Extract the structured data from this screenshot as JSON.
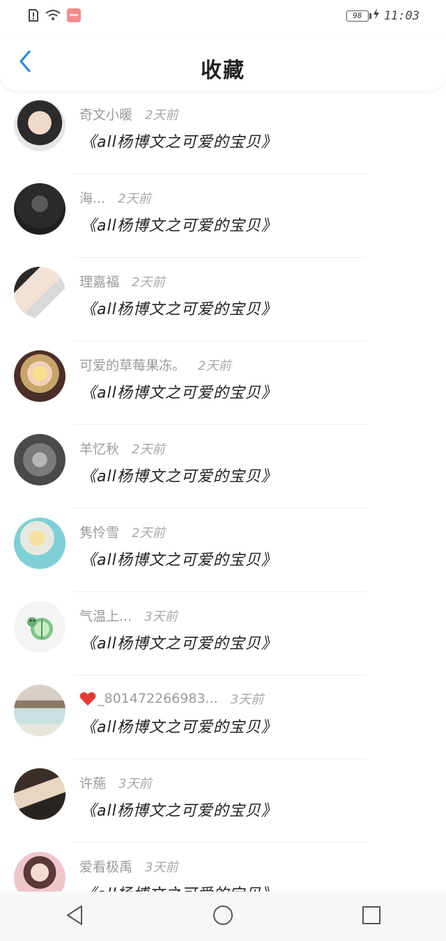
{
  "status_bar": {
    "battery": "98",
    "time": "11:03"
  },
  "header": {
    "title": "收藏"
  },
  "items": [
    {
      "username": "奇文小暖",
      "time": "2天前",
      "title": "《all杨博文之可爱的宝贝》",
      "avatar_color": "#3a3a3a"
    },
    {
      "username": "海...",
      "time": "2天前",
      "title": "《all杨博文之可爱的宝贝》",
      "avatar_color": "#2b2b2b"
    },
    {
      "username": "理嘉福",
      "time": "2天前",
      "title": "《all杨博文之可爱的宝贝》",
      "avatar_color": "#c9b8a8"
    },
    {
      "username": "可爱的草莓果冻。",
      "time": "2天前",
      "title": "《all杨博文之可爱的宝贝》",
      "avatar_color": "#6a4a3a"
    },
    {
      "username": "羊忆秋",
      "time": "2天前",
      "title": "《all杨博文之可爱的宝贝》",
      "avatar_color": "#8a8a8a"
    },
    {
      "username": "隽怜雪",
      "time": "2天前",
      "title": "《all杨博文之可爱的宝贝》",
      "avatar_color": "#7fd0d6"
    },
    {
      "username": "气温上...",
      "time": "3天前",
      "title": "《all杨博文之可爱的宝贝》",
      "avatar_color": "#f0f0f0"
    },
    {
      "username": "_801472266983...",
      "time": "3天前",
      "title": "《all杨博文之可爱的宝贝》",
      "avatar_color": "#b5aca4",
      "heart": true
    },
    {
      "username": "许葹",
      "time": "3天前",
      "title": "《all杨博文之可爱的宝贝》",
      "avatar_color": "#4a3a34"
    },
    {
      "username": "爱看极禹",
      "time": "3天前",
      "title": "《all杨博文之可爱的宝贝》",
      "avatar_color": "#e9c6c9"
    }
  ],
  "colors": {
    "accent": "#1e88e5",
    "heart": "#e53935"
  }
}
